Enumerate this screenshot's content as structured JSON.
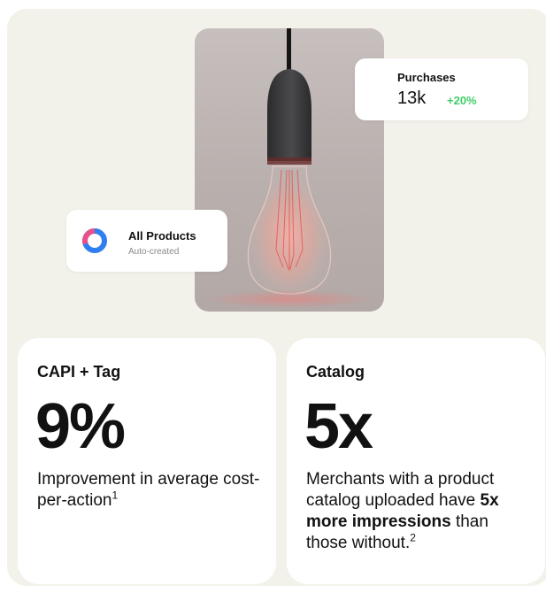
{
  "purchases": {
    "title": "Purchases",
    "value": "13k",
    "delta": "+20%",
    "delta_color": "#3fcf6a"
  },
  "products": {
    "title": "All Products",
    "subtitle": "Auto-created",
    "ring_colors": [
      "#e8508a",
      "#2f7ff0"
    ]
  },
  "capi": {
    "label": "CAPI + Tag",
    "big": "9%",
    "desc": "Improvement in average cost-per-action",
    "footnote": "1"
  },
  "catalog": {
    "label": "Catalog",
    "big": "5x",
    "desc_pre": "Merchants with a product catalog uploaded have",
    "desc_bold": "5x more impressions",
    "desc_post": "than those without.",
    "footnote": "2"
  },
  "photo": {
    "subject": "hanging-edison-bulb"
  }
}
